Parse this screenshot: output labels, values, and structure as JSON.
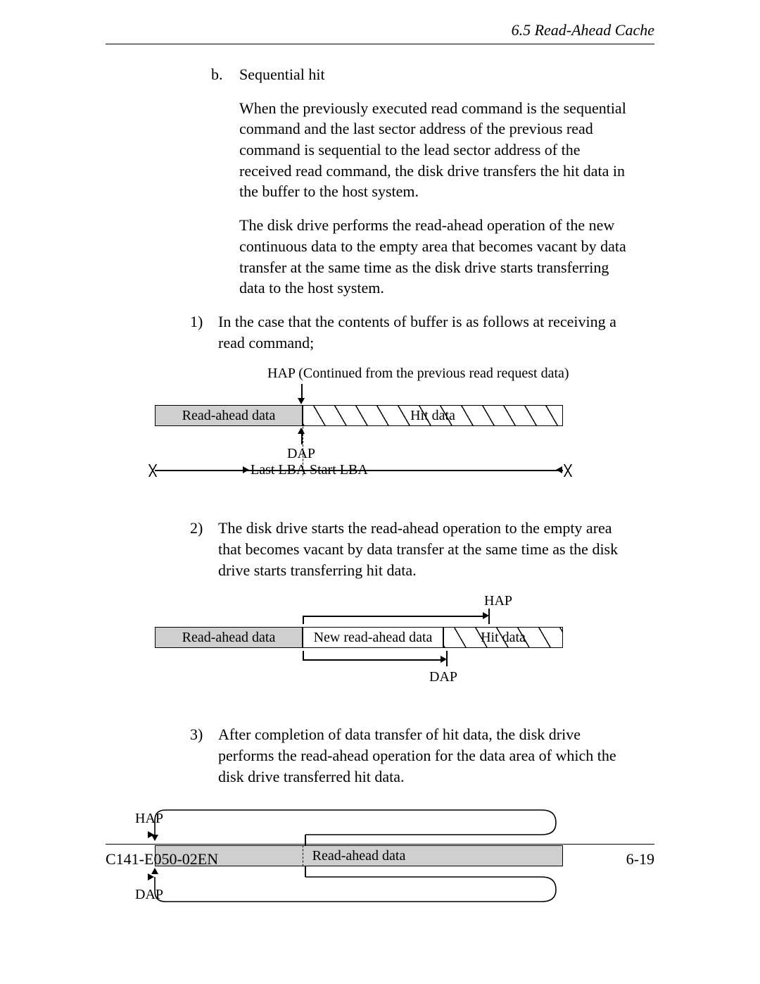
{
  "header": {
    "section": "6.5 Read-Ahead Cache"
  },
  "body": {
    "b_marker": "b.",
    "b_title": "Sequential hit",
    "b_p1": "When the previously executed read command is the sequential command and the last sector address of the previous read command is sequential to the lead sector address of the received read command, the disk drive transfers the hit data in the buffer to the host system.",
    "b_p2": "The disk drive performs the read-ahead operation of the new continuous data to the empty area that becomes vacant by data transfer at the same time as the disk drive starts transferring data to the host system.",
    "n1_marker": "1)",
    "n1_text": "In the case that the contents of buffer is as follows at receiving a read command;",
    "n2_marker": "2)",
    "n2_text": "The disk drive starts the read-ahead operation to the empty area that becomes vacant by data transfer at the same time as the disk drive starts transferring hit data.",
    "n3_marker": "3)",
    "n3_text": "After completion of data transfer of hit data, the disk drive performs the read-ahead operation for the data area of which the disk drive transferred hit data."
  },
  "diagrams": {
    "d1": {
      "caption": "HAP (Continued from the previous read  request data)",
      "read_ahead": "Read-ahead data",
      "hit": "Hit data",
      "dap": "DAP",
      "last_lba": "Last LBA",
      "start_lba": "Start LBA"
    },
    "d2": {
      "hap": "HAP",
      "read_ahead": "Read-ahead data",
      "new_read_ahead": "New read-ahead data",
      "hit": "Hit data",
      "dap": "DAP"
    },
    "d3": {
      "hap": "HAP",
      "read_ahead": "Read-ahead data",
      "dap": "DAP"
    }
  },
  "footer": {
    "doc": "C141-E050-02EN",
    "page": "6-19"
  }
}
